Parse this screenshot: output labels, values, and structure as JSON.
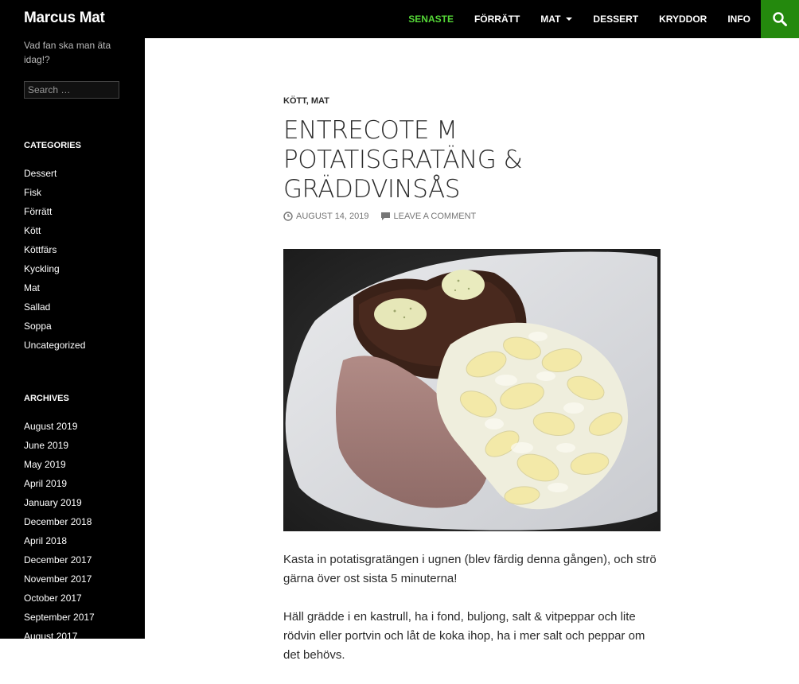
{
  "site": {
    "title": "Marcus Mat",
    "tagline": "Vad fan ska man äta idag!?"
  },
  "nav": {
    "items": [
      {
        "label": "SENASTE",
        "active": true
      },
      {
        "label": "FÖRRÄTT"
      },
      {
        "label": "MAT",
        "has_dropdown": true
      },
      {
        "label": "DESSERT"
      },
      {
        "label": "KRYDDOR"
      },
      {
        "label": "INFO"
      }
    ],
    "search_icon": "search-icon"
  },
  "sidebar": {
    "search_placeholder": "Search …",
    "categories_title": "CATEGORIES",
    "categories": [
      "Dessert",
      "Fisk",
      "Förrätt",
      "Kött",
      "Köttfärs",
      "Kyckling",
      "Mat",
      "Sallad",
      "Soppa",
      "Uncategorized"
    ],
    "archives_title": "ARCHIVES",
    "archives": [
      "August 2019",
      "June 2019",
      "May 2019",
      "April 2019",
      "January 2019",
      "December 2018",
      "April 2018",
      "December 2017",
      "November 2017",
      "October 2017",
      "September 2017",
      "August 2017"
    ]
  },
  "post": {
    "cat1": "KÖTT",
    "sep": ", ",
    "cat2": "MAT",
    "title": "ENTRECOTE M POTATISGRATÄNG & GRÄDDVINSÅS",
    "date": "AUGUST 14, 2019",
    "comment_link": "LEAVE A COMMENT",
    "paragraphs": [
      "Kasta in potatisgratängen i ugnen (blev färdig denna gången), och strö gärna över ost sista 5 minuterna!",
      "Häll grädde i en kastrull, ha i fond, buljong, salt & vitpeppar och lite rödvin eller portvin och låt de koka ihop, ha i mer salt och peppar om det behövs."
    ]
  },
  "colors": {
    "accent": "#24890d",
    "nav_active": "#55d737",
    "sidebar_bg": "#000000"
  }
}
